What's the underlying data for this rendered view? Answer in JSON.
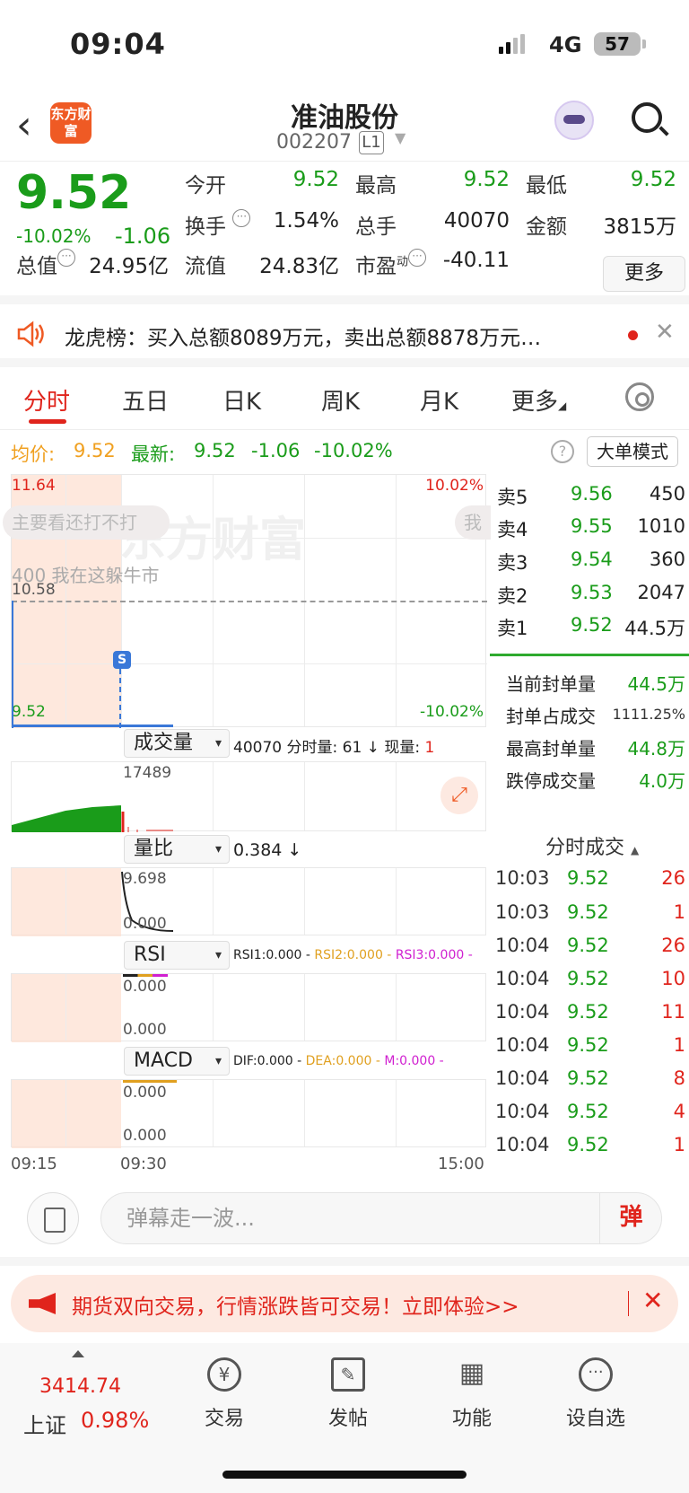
{
  "status_bar": {
    "time": "09:04",
    "network": "4G",
    "battery": "57"
  },
  "nav": {
    "logo_text": "东方财富",
    "title": "准油股份",
    "code": "002207",
    "level_badge": "L1"
  },
  "quote": {
    "price": "9.52",
    "change_pct": "-10.02%",
    "change": "-1.06",
    "open_label": "今开",
    "open": "9.52",
    "high_label": "最高",
    "high": "9.52",
    "low_label": "最低",
    "low": "9.52",
    "turnover_label": "换手",
    "turnover": "1.54%",
    "volume_label": "总手",
    "volume": "40070",
    "amount_label": "金额",
    "amount": "3815万",
    "mktcap_label": "总值",
    "mktcap": "24.95亿",
    "float_label": "流值",
    "float_cap": "24.83亿",
    "pe_label": "市盈",
    "pe_sup": "动",
    "pe": "-40.11",
    "more_label": "更多"
  },
  "dragon_tiger": {
    "text": "龙虎榜：买入总额8089万元，卖出总额8878万元…"
  },
  "tabs": [
    "分时",
    "五日",
    "日K",
    "周K",
    "月K",
    "更多"
  ],
  "avg_line": {
    "avg_label": "均价:",
    "avg": "9.52",
    "latest_label": "最新:",
    "latest": "9.52",
    "change": "-1.06",
    "pct": "-10.02%",
    "mode_label": "大单模式"
  },
  "price_chart": {
    "top_price": "11.64",
    "mid_price": "10.58",
    "bottom_price": "9.52",
    "top_pct": "10.02%",
    "bottom_pct": "-10.02%",
    "watermark": "东方财富",
    "danmu_1": "主要看还打不打",
    "danmu_2": "400 我在这躲牛市",
    "danmu_3": "我",
    "signal_badge": "S"
  },
  "volume_panel": {
    "selector": "成交量",
    "total": "40070",
    "min_label": "分时量:",
    "min_val": "61 ↓",
    "now_label": "现量:",
    "now_val": "1",
    "max": "17489"
  },
  "ratio_panel": {
    "selector": "量比",
    "value": "0.384 ↓",
    "top": "9.698",
    "bottom": "0.000"
  },
  "rsi_panel": {
    "selector": "RSI",
    "rsi1": "RSI1:0.000 -",
    "rsi2": "RSI2:0.000 -",
    "rsi3": "RSI3:0.000 -",
    "top": "0.000",
    "bottom": "0.000"
  },
  "macd_panel": {
    "selector": "MACD",
    "dif": "DIF:0.000 -",
    "dea": "DEA:0.000 -",
    "m": "M:0.000 -",
    "top": "0.000",
    "bottom": "0.000"
  },
  "time_axis": {
    "start": "09:15",
    "open": "09:30",
    "end": "15:00"
  },
  "order_book": [
    {
      "name": "卖5",
      "price": "9.56",
      "vol": "450"
    },
    {
      "name": "卖4",
      "price": "9.55",
      "vol": "1010"
    },
    {
      "name": "卖3",
      "price": "9.54",
      "vol": "360"
    },
    {
      "name": "卖2",
      "price": "9.53",
      "vol": "2047"
    },
    {
      "name": "卖1",
      "price": "9.52",
      "vol": "44.5万"
    }
  ],
  "seal_stats": [
    {
      "label": "当前封单量",
      "value": "44.5万"
    },
    {
      "label": "封单占成交",
      "value": "1111.25%"
    },
    {
      "label": "最高封单量",
      "value": "44.8万"
    },
    {
      "label": "跌停成交量",
      "value": "4.0万"
    }
  ],
  "ticks": {
    "header": "分时成交",
    "rows": [
      {
        "time": "10:03",
        "price": "9.52",
        "vol": "26"
      },
      {
        "time": "10:03",
        "price": "9.52",
        "vol": "1"
      },
      {
        "time": "10:04",
        "price": "9.52",
        "vol": "26"
      },
      {
        "time": "10:04",
        "price": "9.52",
        "vol": "10"
      },
      {
        "time": "10:04",
        "price": "9.52",
        "vol": "11"
      },
      {
        "time": "10:04",
        "price": "9.52",
        "vol": "1"
      },
      {
        "time": "10:04",
        "price": "9.52",
        "vol": "8"
      },
      {
        "time": "10:04",
        "price": "9.52",
        "vol": "4"
      },
      {
        "time": "10:04",
        "price": "9.52",
        "vol": "1"
      }
    ]
  },
  "danmu_input": {
    "placeholder": "弹幕走一波...",
    "send": "弹"
  },
  "banner": {
    "text": "期货双向交易，行情涨跌皆可交易！立即体验>>"
  },
  "bottom_bar": {
    "index_value": "3414.74",
    "index_name": "上证",
    "index_pct": "0.98%",
    "items": [
      "交易",
      "发帖",
      "功能",
      "设自选"
    ]
  },
  "colors": {
    "up": "#e0241c",
    "down": "#1a9c1a",
    "avg": "#f0a020",
    "brand": "#ef5a24"
  }
}
